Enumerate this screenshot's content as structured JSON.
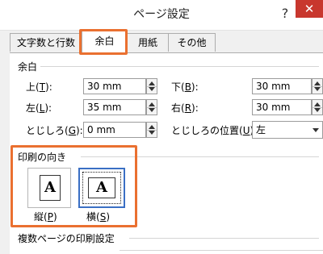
{
  "window": {
    "title": "ページ設定",
    "help": "?",
    "close": "✕"
  },
  "tabs": [
    {
      "label": "文字数と行数"
    },
    {
      "label": "余白"
    },
    {
      "label": "用紙"
    },
    {
      "label": "その他"
    }
  ],
  "margins": {
    "group_title": "余白",
    "top": {
      "label": "上(",
      "key": "T",
      "tail": "):",
      "value": "30 mm"
    },
    "bottom": {
      "label": "下(",
      "key": "B",
      "tail": "):",
      "value": "30 mm"
    },
    "left": {
      "label": "左(",
      "key": "L",
      "tail": "):",
      "value": "35 mm"
    },
    "right": {
      "label": "右(",
      "key": "R",
      "tail": "):",
      "value": "30 mm"
    },
    "gutter": {
      "label": "とじしろ(",
      "key": "G",
      "tail": "):",
      "value": "0 mm"
    },
    "gutter_position": {
      "label": "とじしろの位置(",
      "key": "U",
      "tail": "):",
      "value": "左"
    }
  },
  "orientation": {
    "group_title": "印刷の向き",
    "portrait": {
      "label": "縦(",
      "key": "P",
      "tail": ")",
      "glyph": "A"
    },
    "landscape": {
      "label": "横(",
      "key": "S",
      "tail": ")",
      "glyph": "A"
    }
  },
  "pages": {
    "group_title": "複数ページの印刷設定"
  },
  "colors": {
    "highlight": "#ea7030",
    "close_bg": "#c8372e",
    "selection": "#3a6fc4"
  }
}
